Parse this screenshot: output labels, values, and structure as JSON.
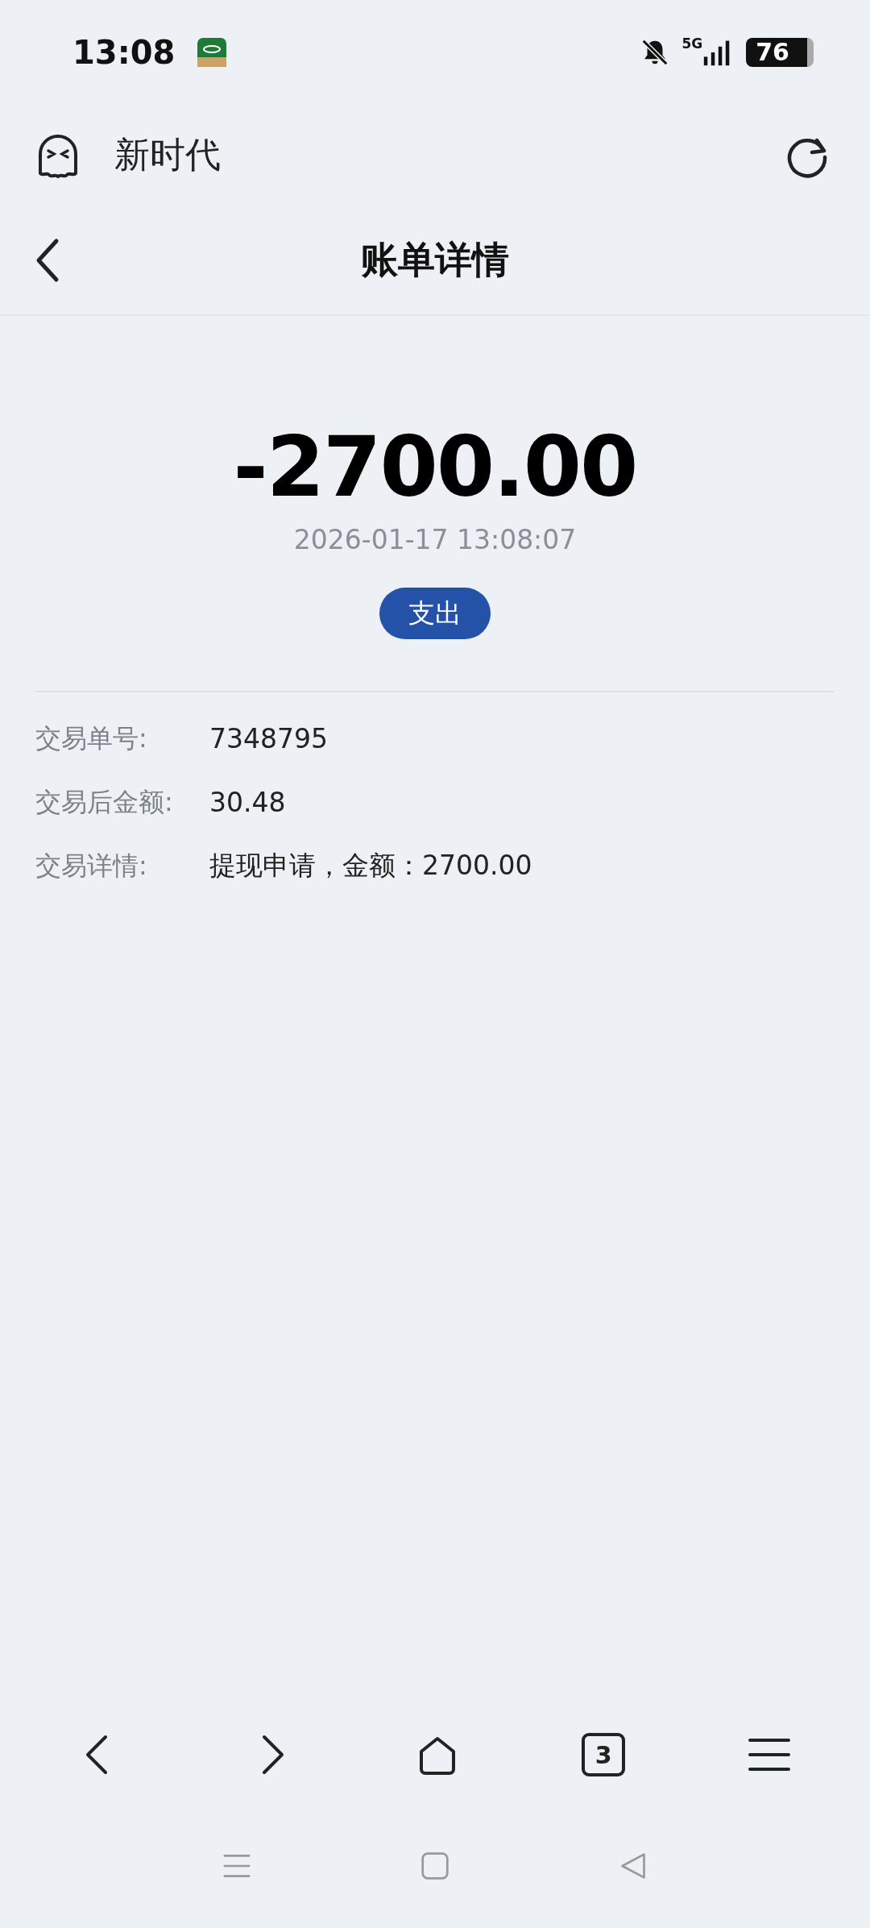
{
  "status_bar": {
    "time": "13:08",
    "network": "5G",
    "battery": "76"
  },
  "browser_bar": {
    "title": "新时代"
  },
  "header": {
    "title": "账单详情"
  },
  "summary": {
    "amount": "-2700.00",
    "datetime": "2026-01-17 13:08:07",
    "type_tag": "支出"
  },
  "details": [
    {
      "label": "交易单号:",
      "value": "7348795"
    },
    {
      "label": "交易后金额:",
      "value": "30.48"
    },
    {
      "label": "交易详情:",
      "value": "提现申请，金额：2700.00"
    }
  ],
  "bottom_toolbar": {
    "tab_count": "3"
  }
}
